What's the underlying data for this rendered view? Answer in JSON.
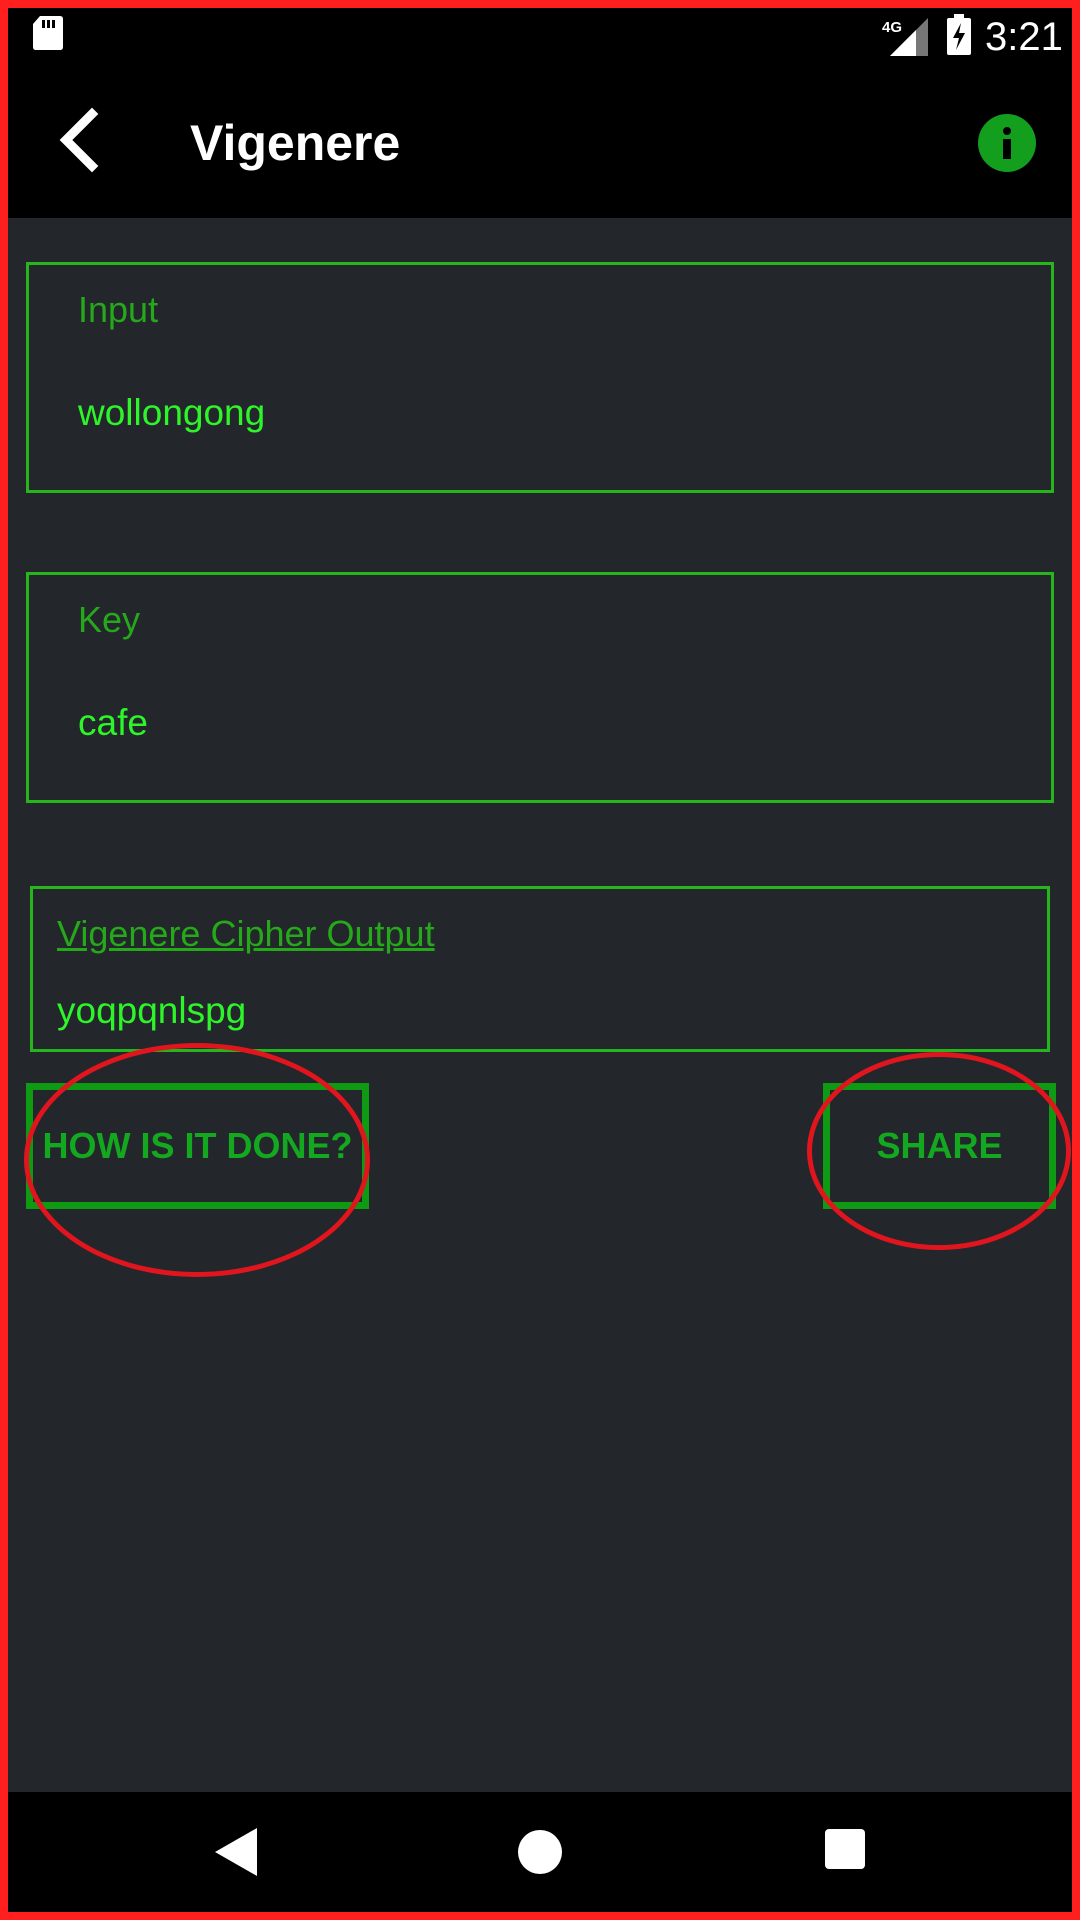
{
  "status_bar": {
    "time": "3:21",
    "network": "4G",
    "icons": [
      "sd-card-icon",
      "signal-icon",
      "battery-charging-icon"
    ]
  },
  "app_bar": {
    "title": "Vigenere",
    "back_icon": "chevron-left-icon",
    "info_icon": "info-icon"
  },
  "form": {
    "input": {
      "label": "Input",
      "value": "wollongong"
    },
    "key": {
      "label": "Key",
      "value": "cafe"
    },
    "output": {
      "label": "Vigenere Cipher Output",
      "value": "yoqpqnlspg"
    }
  },
  "buttons": {
    "how_label": "HOW IS IT DONE?",
    "share_label": "SHARE"
  },
  "nav_bar": {
    "icons": [
      "nav-back-icon",
      "nav-home-icon",
      "nav-recents-icon"
    ]
  },
  "colors": {
    "accent": "#27b51d",
    "text_green": "#2df52a",
    "background": "#23262b",
    "annotation": "#e0151d"
  }
}
